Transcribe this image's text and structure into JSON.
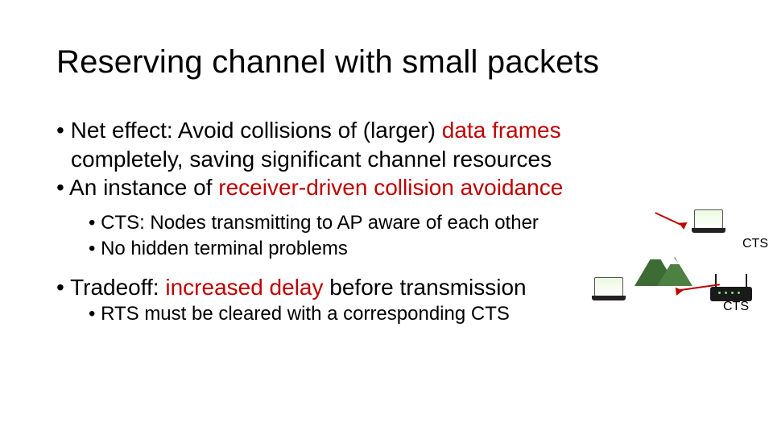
{
  "title": "Reserving channel with small packets",
  "bullets": {
    "a1_pre": "Net effect: Avoid collisions of (larger) ",
    "a1_hl": "data frames",
    "a1_cont": "completely, saving significant channel resources",
    "a2_pre": "An instance of ",
    "a2_hl": "receiver-driven collision avoidance",
    "sub1": "CTS: Nodes transmitting to AP aware of each other",
    "sub2": "No hidden terminal problems",
    "a3_pre": "Tradeoff: ",
    "a3_hl": "increased delay ",
    "a3_post": "before transmission",
    "sub3": "RTS must be cleared with a corresponding CTS"
  },
  "diagram": {
    "cts_label_1": "CTS",
    "cts_label_2": "CTS"
  }
}
